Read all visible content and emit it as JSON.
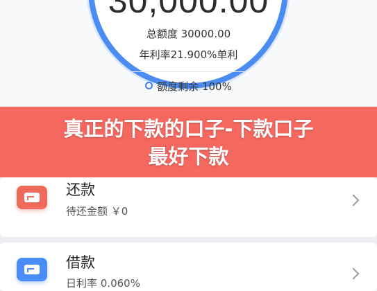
{
  "quota": {
    "amount": "30,000.00",
    "total": "总额度 30000.00",
    "rate": "年利率21.900%单利",
    "remaining": "额度剩余 100%"
  },
  "banner": {
    "line1": "真正的下款的口子-下款口子",
    "line2": "最好下款"
  },
  "repay": {
    "title": "还款",
    "subtitle": "待还金额 ￥0"
  },
  "borrow": {
    "title": "借款",
    "subtitle": "日利率 0.060%"
  },
  "colors": {
    "accent_blue": "#4b8cf3",
    "banner_red": "#f55c52",
    "repay_icon": "#ee6b5c",
    "borrow_icon": "#4b8df6"
  }
}
